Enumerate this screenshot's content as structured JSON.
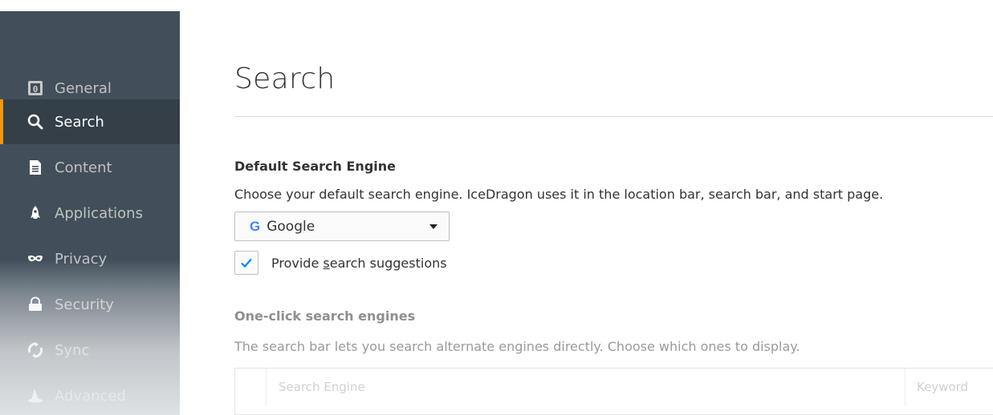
{
  "sidebar": {
    "items": [
      {
        "label": "General",
        "icon": "general-icon",
        "selected": false
      },
      {
        "label": "Search",
        "icon": "search-icon",
        "selected": true
      },
      {
        "label": "Content",
        "icon": "document-icon",
        "selected": false
      },
      {
        "label": "Applications",
        "icon": "rocket-icon",
        "selected": false
      },
      {
        "label": "Privacy",
        "icon": "mask-icon",
        "selected": false
      },
      {
        "label": "Security",
        "icon": "lock-icon",
        "selected": false
      },
      {
        "label": "Sync",
        "icon": "sync-icon",
        "selected": false
      },
      {
        "label": "Advanced",
        "icon": "wizard-hat-icon",
        "selected": false
      }
    ],
    "accent_color": "#ff9500"
  },
  "main": {
    "title": "Search",
    "default_engine": {
      "heading": "Default Search Engine",
      "description": "Choose your default search engine. IceDragon uses it in the location bar, search bar, and start page.",
      "selected_engine": "Google",
      "engine_icon": "G",
      "suggestions_label_pre": "Provide ",
      "suggestions_label_accel": "s",
      "suggestions_label_post": "earch suggestions",
      "suggestions_checked": true
    },
    "one_click": {
      "heading": "One-click search engines",
      "description": "The search bar lets you search alternate engines directly. Choose which ones to display.",
      "columns": [
        "Search Engine",
        "Keyword"
      ]
    }
  }
}
